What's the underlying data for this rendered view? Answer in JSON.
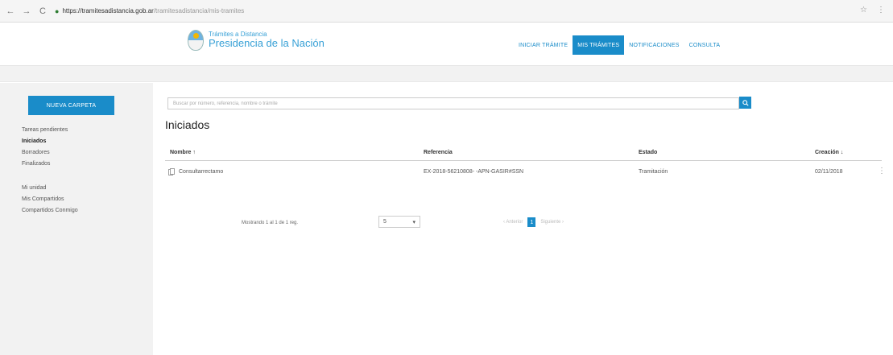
{
  "browser": {
    "url_host": "https://tramitesadistancia.gob.ar",
    "url_path": "/tramitesadistancia/mis-tramites",
    "back": "←",
    "forward": "→",
    "reload": "C",
    "star_icon": "star-icon",
    "menu_icon": "menu-icon"
  },
  "header": {
    "logo_sub": "Trámites a Distancia",
    "logo_main": "Presidencia de la Nación",
    "nav": [
      "INICIAR TRÁMITE",
      "MIS TRÁMITES",
      "NOTIFICACIONES",
      "CONSULTA"
    ],
    "active_index": 1
  },
  "sidebar": {
    "new_folder_label": "NUEVA CARPETA",
    "items": [
      "Tareas pendientes",
      "Iniciados",
      "Borradores",
      "Finalizados"
    ],
    "items_secondary": [
      "Mi unidad",
      "Mis Compartidos",
      "Compartidos Conmigo"
    ]
  },
  "main": {
    "search_placeholder": "Buscar por número, referencia, nombre o trámite",
    "title": "Iniciados",
    "columns": {
      "nombre": "Nombre ↑",
      "referencia": "Referencia",
      "estado": "Estado",
      "creacion": "Creación ↓"
    },
    "rows": [
      {
        "nombre": "Consultarrectamo",
        "referencia": "EX-2018-56210808- -APN-GASIR#SSN",
        "estado": "Tramitación",
        "creacion": "02/11/2018"
      }
    ]
  },
  "pagination": {
    "info": "Mostrando 1 al 1 de 1 reg.",
    "page_size": "5",
    "prev_label": "‹ Anterior",
    "current_page": "1",
    "next_label": "Siguiente ›"
  },
  "colors": {
    "accent": "#1a8cc9",
    "sidebar_bg": "#f2f2f2"
  }
}
